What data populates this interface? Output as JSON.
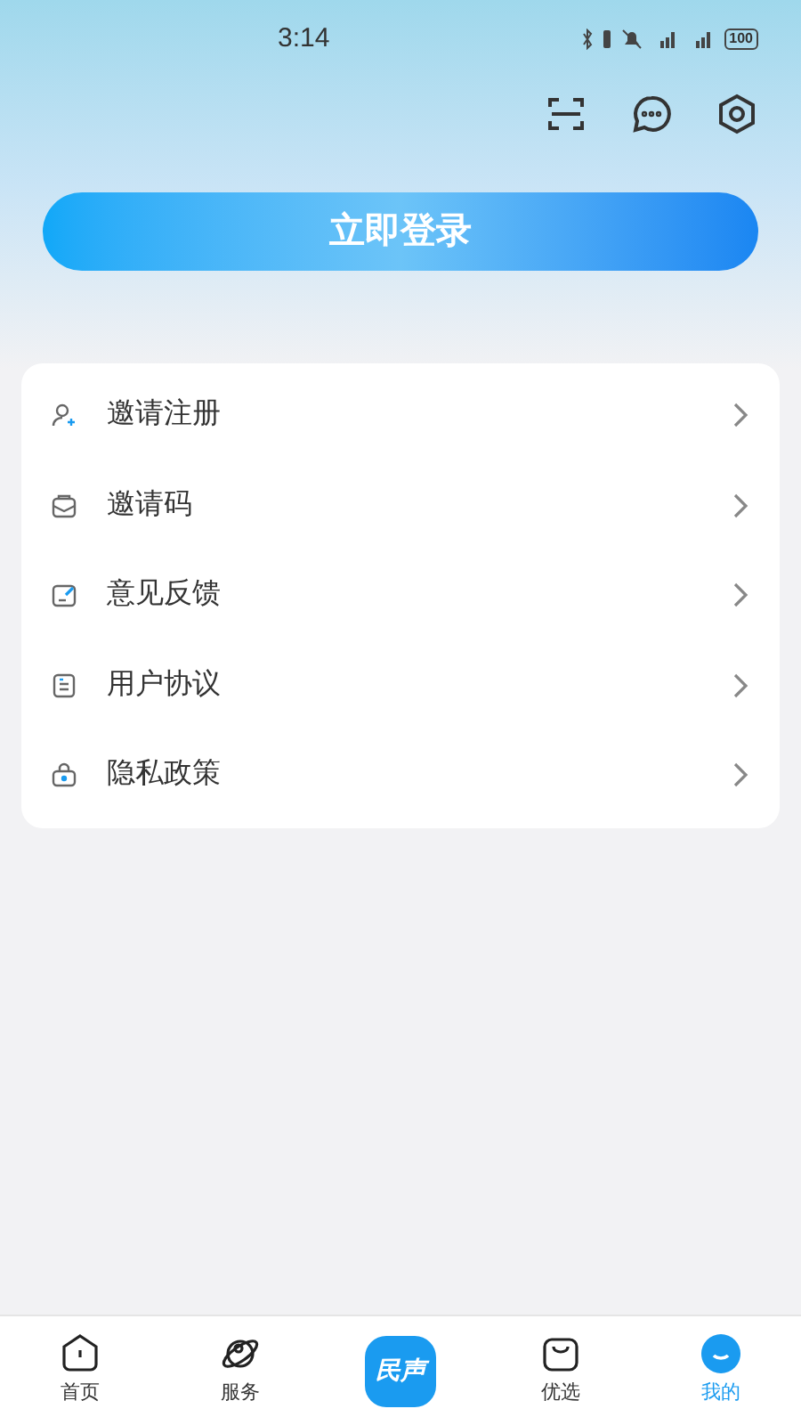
{
  "status_bar": {
    "time": "3:14",
    "battery": "100"
  },
  "login_button": "立即登录",
  "menu": [
    {
      "label": "邀请注册"
    },
    {
      "label": "邀请码"
    },
    {
      "label": "意见反馈"
    },
    {
      "label": "用户协议"
    },
    {
      "label": "隐私政策"
    }
  ],
  "bottom_nav": [
    {
      "kind": "tab",
      "label": "首页",
      "selected": false
    },
    {
      "kind": "tab",
      "label": "服务",
      "selected": false
    },
    {
      "kind": "logo",
      "label": "民声",
      "selected": false
    },
    {
      "kind": "tab",
      "label": "优选",
      "selected": false
    },
    {
      "kind": "tab",
      "label": "我的",
      "selected": true
    }
  ]
}
